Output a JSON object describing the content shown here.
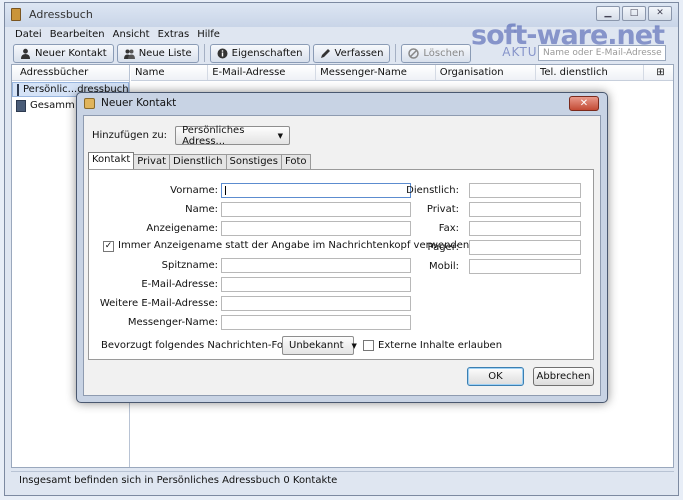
{
  "window": {
    "title": "Adressbuch",
    "controls": {
      "minimize": "▁",
      "maximize": "□",
      "close": "✕"
    }
  },
  "menu": [
    "Datei",
    "Bearbeiten",
    "Ansicht",
    "Extras",
    "Hilfe"
  ],
  "toolbar": {
    "new_contact": "Neuer Kontakt",
    "new_list": "Neue Liste",
    "properties": "Eigenschaften",
    "compose": "Verfassen",
    "delete": "Löschen"
  },
  "watermark": {
    "big": "soft-ware.net",
    "small": "AKTUELLE DOWNLOADS"
  },
  "search": {
    "placeholder": "Name oder E-Mail-Adresse"
  },
  "addressbooks": {
    "header": "Adressbücher",
    "items": [
      "Persönlic...dressbuch",
      "Gesamm"
    ]
  },
  "columns": [
    "Name",
    "E-Mail-Adresse",
    "Messenger-Name",
    "Organisation",
    "Tel. dienstlich"
  ],
  "status": "Insgesamt befinden sich in Persönliches Adressbuch 0 Kontakte",
  "dialog": {
    "title": "Neuer Kontakt",
    "close": "✕",
    "add_to_label": "Hinzufügen zu:",
    "add_to_value": "Persönliches Adress...",
    "tabs": [
      "Kontakt",
      "Privat",
      "Dienstlich",
      "Sonstiges",
      "Foto"
    ],
    "fields_left": {
      "vorname": "Vorname:",
      "name": "Name:",
      "anzeigename": "Anzeigename:",
      "spitzname": "Spitzname:",
      "email": "E-Mail-Adresse:",
      "weitere_email": "Weitere E-Mail-Adresse:",
      "messenger": "Messenger-Name:"
    },
    "fields_right": {
      "dienstlich": "Dienstlich:",
      "privat": "Privat:",
      "fax": "Fax:",
      "pager": "Pager:",
      "mobil": "Mobil:"
    },
    "checkbox_display_name": "Immer Anzeigename statt der Angabe im Nachrichtenkopf verwenden",
    "format_label": "Bevorzugt folgendes Nachrichten-Format:",
    "format_value": "Unbekannt",
    "external_content": "Externe Inhalte erlauben",
    "ok": "OK",
    "cancel": "Abbrechen"
  }
}
